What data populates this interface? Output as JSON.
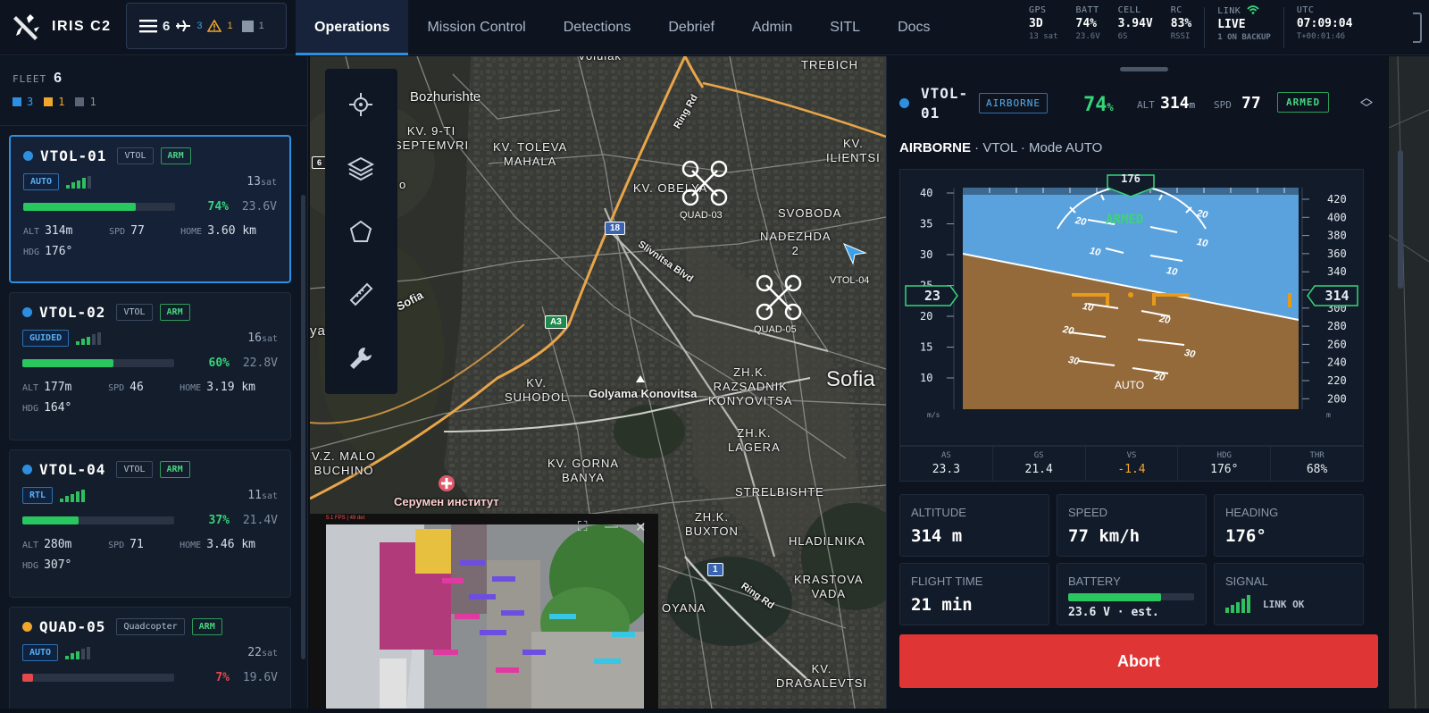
{
  "app": {
    "title": "IRIS C2"
  },
  "fleet_pill": {
    "total": "6",
    "blue": "3",
    "orange": "1",
    "gray": "1"
  },
  "tabs": [
    {
      "label": "Operations"
    },
    {
      "label": "Mission Control"
    },
    {
      "label": "Detections"
    },
    {
      "label": "Debrief"
    },
    {
      "label": "Admin"
    },
    {
      "label": "SITL"
    },
    {
      "label": "Docs"
    }
  ],
  "telemetry": {
    "gps": {
      "label": "GPS",
      "value": "3D",
      "sub": "13 sat"
    },
    "batt": {
      "label": "BATT",
      "value": "74%",
      "sub": "23.6V"
    },
    "cell": {
      "label": "CELL",
      "value": "3.94V",
      "sub": "6S"
    },
    "rc": {
      "label": "RC",
      "value": "83%",
      "sub": "RSSI"
    },
    "link": {
      "label": "LINK",
      "value": "LIVE",
      "sub": "1 ON BACKUP"
    },
    "utc": {
      "label": "UTC",
      "value": "07:09:04",
      "sub": "T+00:01:46"
    }
  },
  "sidebar": {
    "fleet_label": "FLEET",
    "fleet_count": "6",
    "counts": {
      "blue": "3",
      "orange": "1",
      "gray": "1"
    },
    "vehicles": [
      {
        "name": "VTOL-01",
        "type": "VTOL",
        "arm": "ARM",
        "mode": "AUTO",
        "sats": "13",
        "sat_unit": "sat",
        "battery_pct": "74%",
        "battery_fraction": 0.74,
        "voltage": "23.6V",
        "alt": "314m",
        "spd": "77",
        "home": "3.60 km",
        "hdg": "176°",
        "status_color": "#2e8fe0",
        "signal_bars": 4,
        "battery_color": "#29c760"
      },
      {
        "name": "VTOL-02",
        "type": "VTOL",
        "arm": "ARM",
        "mode": "GUIDED",
        "sats": "16",
        "sat_unit": "sat",
        "battery_pct": "60%",
        "battery_fraction": 0.6,
        "voltage": "22.8V",
        "alt": "177m",
        "spd": "46",
        "home": "3.19 km",
        "hdg": "164°",
        "status_color": "#2e8fe0",
        "signal_bars": 3,
        "battery_color": "#29c760"
      },
      {
        "name": "VTOL-04",
        "type": "VTOL",
        "arm": "ARM",
        "mode": "RTL",
        "sats": "11",
        "sat_unit": "sat",
        "battery_pct": "37%",
        "battery_fraction": 0.37,
        "voltage": "21.4V",
        "alt": "280m",
        "spd": "71",
        "home": "3.46 km",
        "hdg": "307°",
        "status_color": "#2e8fe0",
        "signal_bars": 5,
        "battery_color": "#29c760"
      },
      {
        "name": "QUAD-05",
        "type": "Quadcopter",
        "arm": "ARM",
        "mode": "AUTO",
        "sats": "22",
        "sat_unit": "sat",
        "battery_pct": "7%",
        "battery_fraction": 0.07,
        "voltage": "19.6V",
        "status_color": "#f0a52c",
        "signal_bars": 3,
        "battery_color": "#e5484d"
      }
    ],
    "labels": {
      "alt": "ALT",
      "spd": "SPD",
      "home": "HOME",
      "hdg": "HDG"
    }
  },
  "map": {
    "labels": {
      "voluiak": "Voluiak",
      "trebich": "TREBICH",
      "bozhurishte": "Bozhurishte",
      "kv9": "KV. 9-TI\nSEPTEMVRI",
      "toleva": "KV. TOLEVA\nMAHALA",
      "ilientsi": "KV.\nILIENTSI",
      "obelya": "KV. OBELYA",
      "svoboda": "SVOBODA",
      "nadezhda": "NADEZHDA\n2",
      "sofia_road": "Sofia",
      "ringrd1": "Ring Rd",
      "slivnitsa": "Slivnitsa Blvd",
      "suhodol": "KV.\nSUHODOL",
      "golyama": "Golyama Konovitsa",
      "razsadnik": "ZH.K.\nRAZSADNIK\nKONYOVITSA",
      "sofia": "Sofia",
      "lagera": "ZH.K.\nLAGERA",
      "malo": "V.Z. MALO\nBUCHINO",
      "gorna": "KV. GORNA\nBANYA",
      "serumen": "Серумен институт",
      "strelbishte": "STRELBISHTE",
      "buxton": "ZH.K.\nBUXTON",
      "hladilnika": "HLADILNIKA",
      "krastova": "KRASTOVA\nVADA",
      "ringrd2": "Ring Rd",
      "oyana": "OYANA",
      "dragalevtsi": "KV.\nDRAGALEVTSI",
      "va": "ya",
      "o": "o"
    },
    "shields": {
      "s18": "18",
      "a3": "A3",
      "s1": "1",
      "s6": "6"
    },
    "drones": {
      "quad03": "QUAD-03",
      "quad05": "QUAD-05",
      "vtol04": "VTOL-04"
    },
    "video": {
      "header": "5.1 FPS  |  49 det"
    }
  },
  "panel": {
    "name": "VTOL-01",
    "state": "AIRBORNE",
    "battery": "74",
    "battery_unit": "%",
    "alt_label": "ALT",
    "alt_value": "314",
    "alt_unit": "m",
    "spd_label": "SPD",
    "spd_value": "77",
    "armed": "ARMED",
    "subtitle_state": "AIRBORNE",
    "subtitle_rest": " · VTOL · Mode AUTO",
    "pfd": {
      "heading": "176",
      "speed": "23",
      "altitude": "314",
      "armed": "ARMED",
      "mode": "AUTO",
      "speed_unit": "m/s",
      "alt_unit": "m",
      "speed_ticks": [
        "40",
        "35",
        "30",
        "25",
        "20",
        "15",
        "10"
      ],
      "alt_ticks": [
        "420",
        "400",
        "380",
        "360",
        "340",
        "320",
        "300",
        "280",
        "260",
        "240",
        "220",
        "200"
      ],
      "pitch_labels": [
        "20",
        "10",
        "10",
        "20",
        "30"
      ],
      "roll_labels": [
        "20",
        "30"
      ]
    },
    "readouts": [
      {
        "label": "AS",
        "value": "23.3"
      },
      {
        "label": "GS",
        "value": "21.4"
      },
      {
        "label": "VS",
        "value": "-1.4"
      },
      {
        "label": "HDG",
        "value": "176°"
      },
      {
        "label": "THR",
        "value": "68%"
      }
    ],
    "stats": {
      "altitude": {
        "label": "ALTITUDE",
        "value": "314 m"
      },
      "speed": {
        "label": "SPEED",
        "value": "77 km/h"
      },
      "heading": {
        "label": "HEADING",
        "value": "176°"
      },
      "flight_time": {
        "label": "FLIGHT TIME",
        "value": "21 min"
      },
      "battery": {
        "label": "BATTERY",
        "value": "23.6 V · est.",
        "fraction": 0.74
      },
      "signal": {
        "label": "SIGNAL",
        "value": "LINK OK"
      }
    },
    "abort_label": "Abort"
  },
  "colors": {
    "accent": "#2e8fe0",
    "ok": "#36d67a",
    "warn": "#f0a52c",
    "danger": "#e03535"
  }
}
